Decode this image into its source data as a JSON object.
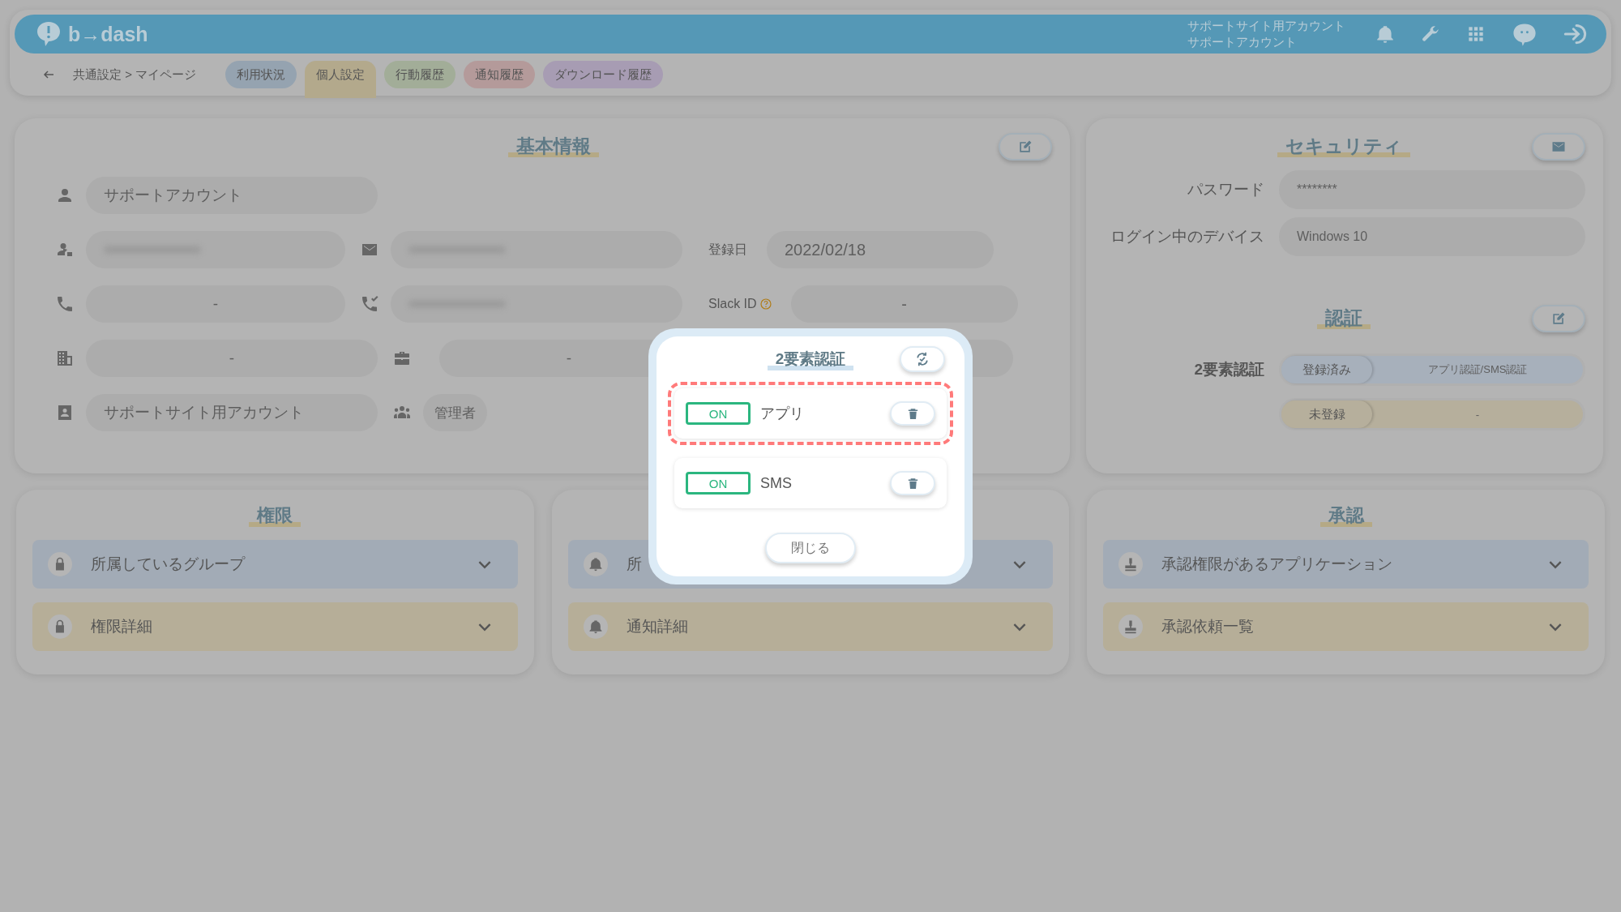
{
  "header": {
    "logo": "b→dash",
    "account_org": "サポートサイト用アカウント",
    "account_name": "サポートアカウント"
  },
  "breadcrumb": {
    "path": "共通設定 > マイページ"
  },
  "tabs": [
    {
      "label": "利用状況",
      "selected": false,
      "color": "#95a3b0"
    },
    {
      "label": "個人設定",
      "selected": true,
      "color": "#b3a98c"
    },
    {
      "label": "行動履歴",
      "selected": false,
      "color": "#a2ad98"
    },
    {
      "label": "通知履歴",
      "selected": false,
      "color": "#b49a9a"
    },
    {
      "label": "ダウンロード履歴",
      "selected": false,
      "color": "#a79cb3"
    }
  ],
  "basic_info": {
    "title": "基本情報",
    "rows": [
      [
        {
          "kind": "person",
          "value": "サポートアカウント"
        }
      ],
      [
        {
          "kind": "person-tag",
          "masked": true
        },
        {
          "kind": "mail",
          "masked": true
        },
        {
          "label": "登録日",
          "value": "2022/02/18"
        }
      ],
      [
        {
          "kind": "phone",
          "value": "-"
        },
        {
          "kind": "phone-check",
          "masked": true
        },
        {
          "label": "Slack ID",
          "help": true,
          "value": "-"
        }
      ],
      [
        {
          "kind": "building",
          "value": "-"
        },
        {
          "kind": "briefcase",
          "value": "-"
        }
      ],
      [
        {
          "kind": "id-card",
          "value": "サポートサイト用アカウント"
        },
        {
          "kind": "people",
          "value": "管理者",
          "chip": true
        }
      ]
    ]
  },
  "security": {
    "title": "セキュリティ",
    "fields": [
      {
        "label": "パスワード",
        "value": "********"
      },
      {
        "label": "ログイン中のデバイス",
        "value": "Windows 10"
      }
    ],
    "auth_title": "認証",
    "two_factor_label": "2要素認証",
    "statuses": [
      {
        "status": "登録済み",
        "detail": "アプリ認証/SMS認証",
        "color": "#a7b0bb"
      },
      {
        "status": "未登録",
        "detail": "-",
        "color": "#b6af9c"
      }
    ]
  },
  "sections": [
    {
      "title": "権限",
      "items": [
        {
          "label": "所属しているグループ",
          "kind": "lock",
          "color": "#a2abb6"
        },
        {
          "label": "権限詳細",
          "kind": "lock",
          "color": "#b6ae98"
        }
      ]
    },
    {
      "items": [
        {
          "label": "所",
          "kind": "bell",
          "color": "#a2abb6"
        },
        {
          "label": "通知詳細",
          "kind": "bell",
          "color": "#b6ae98"
        }
      ]
    },
    {
      "title": "承認",
      "items": [
        {
          "label": "承認権限があるアプリケーション",
          "kind": "stamp",
          "color": "#a2abb6"
        },
        {
          "label": "承認依頼一覧",
          "kind": "stamp",
          "color": "#b6ae98"
        }
      ]
    }
  ],
  "modal": {
    "title": "2要素認証",
    "methods": [
      {
        "toggle": "ON",
        "on": true,
        "label": "アプリ",
        "highlighted": true
      },
      {
        "toggle": "ON",
        "on": true,
        "label": "SMS",
        "highlighted": false
      }
    ],
    "close": "閉じる"
  }
}
